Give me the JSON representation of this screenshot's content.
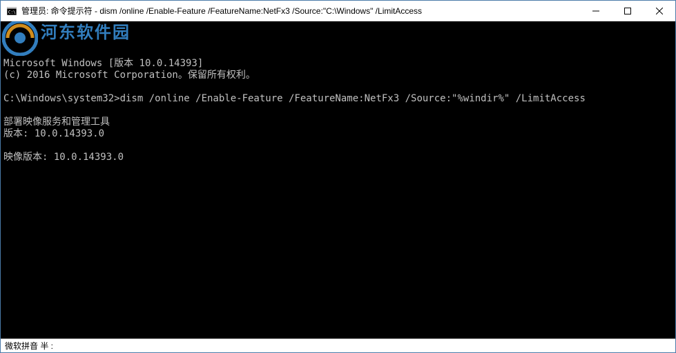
{
  "titlebar": {
    "title": "管理员: 命令提示符 - dism  /online /Enable-Feature /FeatureName:NetFx3 /Source:\"C:\\Windows\" /LimitAccess"
  },
  "terminal": {
    "lines": [
      "Microsoft Windows [版本 10.0.14393]",
      "(c) 2016 Microsoft Corporation。保留所有权利。",
      "",
      "C:\\Windows\\system32>dism /online /Enable-Feature /FeatureName:NetFx3 /Source:\"%windir%\" /LimitAccess",
      "",
      "部署映像服务和管理工具",
      "版本: 10.0.14393.0",
      "",
      "映像版本: 10.0.14393.0"
    ]
  },
  "watermark": {
    "text": "河东软件园"
  },
  "ime": {
    "text": "微软拼音 半 :"
  }
}
